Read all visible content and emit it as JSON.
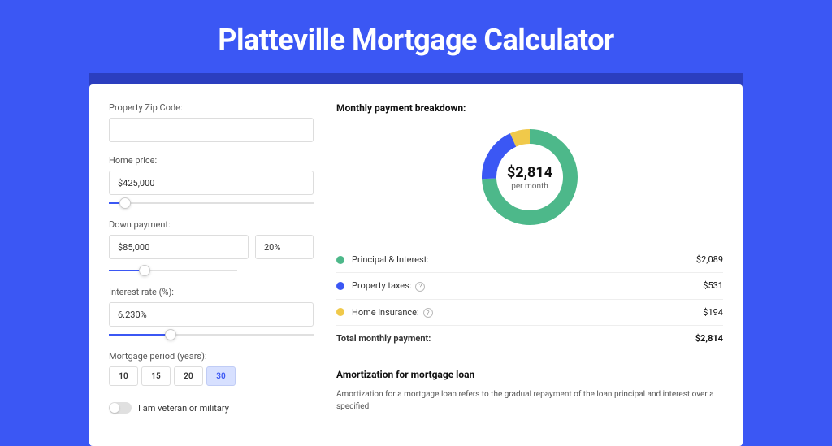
{
  "title": "Platteville Mortgage Calculator",
  "form": {
    "zip_label": "Property Zip Code:",
    "zip_value": "",
    "home_price_label": "Home price:",
    "home_price_value": "$425,000",
    "home_price_slider_pct": 8,
    "down_payment_label": "Down payment:",
    "down_payment_value": "$85,000",
    "down_payment_pct": "20%",
    "down_payment_slider_pct": 20,
    "interest_label": "Interest rate (%):",
    "interest_value": "6.230%",
    "interest_slider_pct": 30,
    "period_label": "Mortgage period (years):",
    "periods": [
      "10",
      "15",
      "20",
      "30"
    ],
    "period_active": "30",
    "veteran_label": "I am veteran or military"
  },
  "breakdown": {
    "heading": "Monthly payment breakdown:",
    "center_amount": "$2,814",
    "center_unit": "per month",
    "items": [
      {
        "label": "Principal & Interest:",
        "value": "$2,089",
        "color": "#4DB88A",
        "info": false
      },
      {
        "label": "Property taxes:",
        "value": "$531",
        "color": "#3B57F4",
        "info": true
      },
      {
        "label": "Home insurance:",
        "value": "$194",
        "color": "#F0C94A",
        "info": true
      }
    ],
    "total_label": "Total monthly payment:",
    "total_value": "$2,814"
  },
  "amortization": {
    "heading": "Amortization for mortgage loan",
    "text": "Amortization for a mortgage loan refers to the gradual repayment of the loan principal and interest over a specified"
  },
  "chart_data": {
    "type": "pie",
    "title": "Monthly payment breakdown",
    "total": 2814,
    "unit": "USD per month",
    "series": [
      {
        "name": "Principal & Interest",
        "value": 2089,
        "color": "#4DB88A"
      },
      {
        "name": "Property taxes",
        "value": 531,
        "color": "#3B57F4"
      },
      {
        "name": "Home insurance",
        "value": 194,
        "color": "#F0C94A"
      }
    ]
  }
}
